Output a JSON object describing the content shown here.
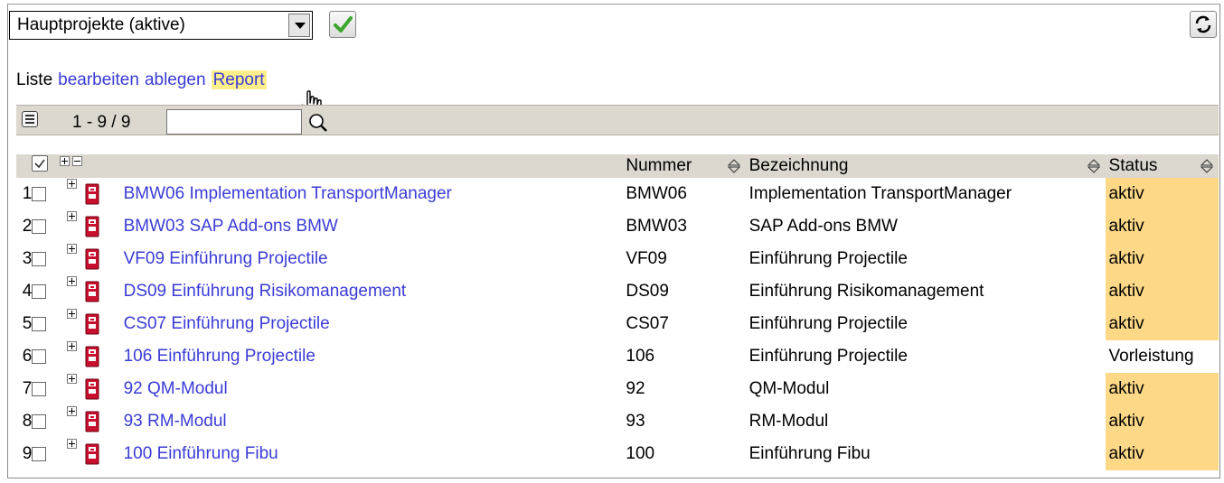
{
  "toolbar": {
    "filter_select_value": "Hauptprojekte (aktive)",
    "accent_green": "#3aa62c"
  },
  "actions": {
    "prefix": "Liste",
    "edit": "bearbeiten",
    "file": "ablegen",
    "report": "Report"
  },
  "pager": {
    "range": "1 - 9 / 9",
    "search_value": ""
  },
  "table": {
    "columns": {
      "number": "Nummer",
      "title": "Bezeichnung",
      "status": "Status"
    },
    "rows": [
      {
        "idx": "1",
        "name": "BMW06 Implementation TransportManager",
        "number": "BMW06",
        "title": "Implementation TransportManager",
        "status": "aktiv"
      },
      {
        "idx": "2",
        "name": "BMW03 SAP Add-ons BMW",
        "number": "BMW03",
        "title": "SAP Add-ons BMW",
        "status": "aktiv"
      },
      {
        "idx": "3",
        "name": "VF09 Einführung Projectile",
        "number": "VF09",
        "title": "Einführung Projectile",
        "status": "aktiv"
      },
      {
        "idx": "4",
        "name": "DS09 Einführung Risikomanagement",
        "number": "DS09",
        "title": "Einführung Risikomanagement",
        "status": "aktiv"
      },
      {
        "idx": "5",
        "name": "CS07 Einführung Projectile",
        "number": "CS07",
        "title": "Einführung Projectile",
        "status": "aktiv"
      },
      {
        "idx": "6",
        "name": "106 Einführung Projectile",
        "number": "106",
        "title": "Einführung Projectile",
        "status": "Vorleistung"
      },
      {
        "idx": "7",
        "name": "92 QM-Modul",
        "number": "92",
        "title": "QM-Modul",
        "status": "aktiv"
      },
      {
        "idx": "8",
        "name": "93 RM-Modul",
        "number": "93",
        "title": "RM-Modul",
        "status": "aktiv"
      },
      {
        "idx": "9",
        "name": "100 Einführung Fibu",
        "number": "100",
        "title": "Einführung Fibu",
        "status": "aktiv"
      }
    ]
  },
  "colors": {
    "status_active_bg": "#fcd887",
    "link": "#3b3bd6",
    "header_bg": "#dcd8d0",
    "report_highlight": "#fdee8c",
    "project_icon": "#c8102e"
  }
}
